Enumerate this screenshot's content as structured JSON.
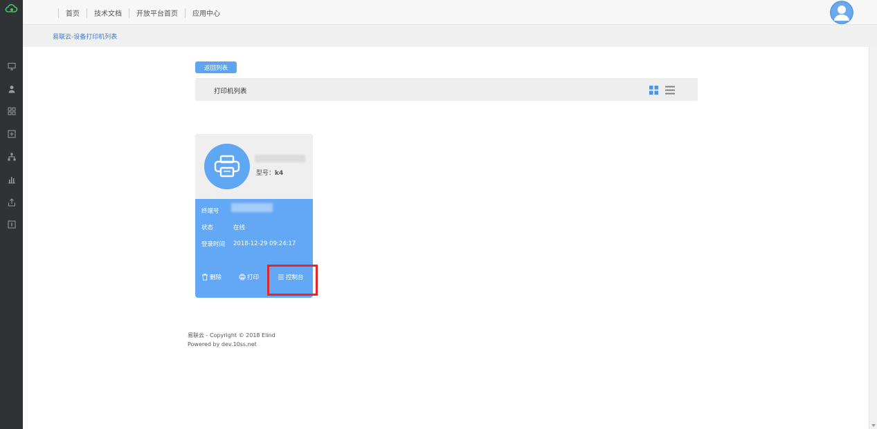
{
  "topnav": [
    "首页",
    "技术文档",
    "开放平台首页",
    "应用中心"
  ],
  "breadcrumb": "易联云-设备打印机列表",
  "back_button": "返回列表",
  "list_title": "打印机列表",
  "sidebar_icons": [
    "monitor-icon",
    "user-icon",
    "grid-apps-icon",
    "add-box-icon",
    "sitemap-icon",
    "bar-chart-icon",
    "upload-icon",
    "info-box-icon"
  ],
  "card": {
    "model_label": "型号：",
    "model_value": "k4",
    "terminal_label": "终端号",
    "status_label": "状态",
    "status_value": "在线",
    "login_label": "登录时间",
    "login_value": "2018-12-29 09:24:17",
    "actions": {
      "delete": "删除",
      "print": "打印",
      "console": "控制台"
    }
  },
  "footer": {
    "line1": "易联云 - Copyright © 2018 Elind",
    "line2": "Powered by dev.10ss.net"
  },
  "colors": {
    "accent": "#63a8f5",
    "sidebar": "#2f3336",
    "highlight": "#e32626"
  }
}
